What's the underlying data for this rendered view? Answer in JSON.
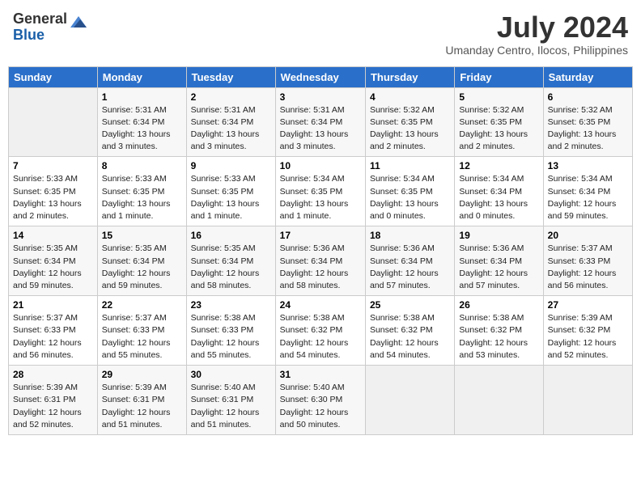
{
  "header": {
    "logo_general": "General",
    "logo_blue": "Blue",
    "month_year": "July 2024",
    "location": "Umanday Centro, Ilocos, Philippines"
  },
  "days_of_week": [
    "Sunday",
    "Monday",
    "Tuesday",
    "Wednesday",
    "Thursday",
    "Friday",
    "Saturday"
  ],
  "weeks": [
    [
      {
        "num": "",
        "empty": true
      },
      {
        "num": "1",
        "sunrise": "Sunrise: 5:31 AM",
        "sunset": "Sunset: 6:34 PM",
        "daylight": "Daylight: 13 hours and 3 minutes."
      },
      {
        "num": "2",
        "sunrise": "Sunrise: 5:31 AM",
        "sunset": "Sunset: 6:34 PM",
        "daylight": "Daylight: 13 hours and 3 minutes."
      },
      {
        "num": "3",
        "sunrise": "Sunrise: 5:31 AM",
        "sunset": "Sunset: 6:34 PM",
        "daylight": "Daylight: 13 hours and 3 minutes."
      },
      {
        "num": "4",
        "sunrise": "Sunrise: 5:32 AM",
        "sunset": "Sunset: 6:35 PM",
        "daylight": "Daylight: 13 hours and 2 minutes."
      },
      {
        "num": "5",
        "sunrise": "Sunrise: 5:32 AM",
        "sunset": "Sunset: 6:35 PM",
        "daylight": "Daylight: 13 hours and 2 minutes."
      },
      {
        "num": "6",
        "sunrise": "Sunrise: 5:32 AM",
        "sunset": "Sunset: 6:35 PM",
        "daylight": "Daylight: 13 hours and 2 minutes."
      }
    ],
    [
      {
        "num": "7",
        "sunrise": "Sunrise: 5:33 AM",
        "sunset": "Sunset: 6:35 PM",
        "daylight": "Daylight: 13 hours and 2 minutes."
      },
      {
        "num": "8",
        "sunrise": "Sunrise: 5:33 AM",
        "sunset": "Sunset: 6:35 PM",
        "daylight": "Daylight: 13 hours and 1 minute."
      },
      {
        "num": "9",
        "sunrise": "Sunrise: 5:33 AM",
        "sunset": "Sunset: 6:35 PM",
        "daylight": "Daylight: 13 hours and 1 minute."
      },
      {
        "num": "10",
        "sunrise": "Sunrise: 5:34 AM",
        "sunset": "Sunset: 6:35 PM",
        "daylight": "Daylight: 13 hours and 1 minute."
      },
      {
        "num": "11",
        "sunrise": "Sunrise: 5:34 AM",
        "sunset": "Sunset: 6:35 PM",
        "daylight": "Daylight: 13 hours and 0 minutes."
      },
      {
        "num": "12",
        "sunrise": "Sunrise: 5:34 AM",
        "sunset": "Sunset: 6:34 PM",
        "daylight": "Daylight: 13 hours and 0 minutes."
      },
      {
        "num": "13",
        "sunrise": "Sunrise: 5:34 AM",
        "sunset": "Sunset: 6:34 PM",
        "daylight": "Daylight: 12 hours and 59 minutes."
      }
    ],
    [
      {
        "num": "14",
        "sunrise": "Sunrise: 5:35 AM",
        "sunset": "Sunset: 6:34 PM",
        "daylight": "Daylight: 12 hours and 59 minutes."
      },
      {
        "num": "15",
        "sunrise": "Sunrise: 5:35 AM",
        "sunset": "Sunset: 6:34 PM",
        "daylight": "Daylight: 12 hours and 59 minutes."
      },
      {
        "num": "16",
        "sunrise": "Sunrise: 5:35 AM",
        "sunset": "Sunset: 6:34 PM",
        "daylight": "Daylight: 12 hours and 58 minutes."
      },
      {
        "num": "17",
        "sunrise": "Sunrise: 5:36 AM",
        "sunset": "Sunset: 6:34 PM",
        "daylight": "Daylight: 12 hours and 58 minutes."
      },
      {
        "num": "18",
        "sunrise": "Sunrise: 5:36 AM",
        "sunset": "Sunset: 6:34 PM",
        "daylight": "Daylight: 12 hours and 57 minutes."
      },
      {
        "num": "19",
        "sunrise": "Sunrise: 5:36 AM",
        "sunset": "Sunset: 6:34 PM",
        "daylight": "Daylight: 12 hours and 57 minutes."
      },
      {
        "num": "20",
        "sunrise": "Sunrise: 5:37 AM",
        "sunset": "Sunset: 6:33 PM",
        "daylight": "Daylight: 12 hours and 56 minutes."
      }
    ],
    [
      {
        "num": "21",
        "sunrise": "Sunrise: 5:37 AM",
        "sunset": "Sunset: 6:33 PM",
        "daylight": "Daylight: 12 hours and 56 minutes."
      },
      {
        "num": "22",
        "sunrise": "Sunrise: 5:37 AM",
        "sunset": "Sunset: 6:33 PM",
        "daylight": "Daylight: 12 hours and 55 minutes."
      },
      {
        "num": "23",
        "sunrise": "Sunrise: 5:38 AM",
        "sunset": "Sunset: 6:33 PM",
        "daylight": "Daylight: 12 hours and 55 minutes."
      },
      {
        "num": "24",
        "sunrise": "Sunrise: 5:38 AM",
        "sunset": "Sunset: 6:32 PM",
        "daylight": "Daylight: 12 hours and 54 minutes."
      },
      {
        "num": "25",
        "sunrise": "Sunrise: 5:38 AM",
        "sunset": "Sunset: 6:32 PM",
        "daylight": "Daylight: 12 hours and 54 minutes."
      },
      {
        "num": "26",
        "sunrise": "Sunrise: 5:38 AM",
        "sunset": "Sunset: 6:32 PM",
        "daylight": "Daylight: 12 hours and 53 minutes."
      },
      {
        "num": "27",
        "sunrise": "Sunrise: 5:39 AM",
        "sunset": "Sunset: 6:32 PM",
        "daylight": "Daylight: 12 hours and 52 minutes."
      }
    ],
    [
      {
        "num": "28",
        "sunrise": "Sunrise: 5:39 AM",
        "sunset": "Sunset: 6:31 PM",
        "daylight": "Daylight: 12 hours and 52 minutes."
      },
      {
        "num": "29",
        "sunrise": "Sunrise: 5:39 AM",
        "sunset": "Sunset: 6:31 PM",
        "daylight": "Daylight: 12 hours and 51 minutes."
      },
      {
        "num": "30",
        "sunrise": "Sunrise: 5:40 AM",
        "sunset": "Sunset: 6:31 PM",
        "daylight": "Daylight: 12 hours and 51 minutes."
      },
      {
        "num": "31",
        "sunrise": "Sunrise: 5:40 AM",
        "sunset": "Sunset: 6:30 PM",
        "daylight": "Daylight: 12 hours and 50 minutes."
      },
      {
        "num": "",
        "empty": true
      },
      {
        "num": "",
        "empty": true
      },
      {
        "num": "",
        "empty": true
      }
    ]
  ]
}
